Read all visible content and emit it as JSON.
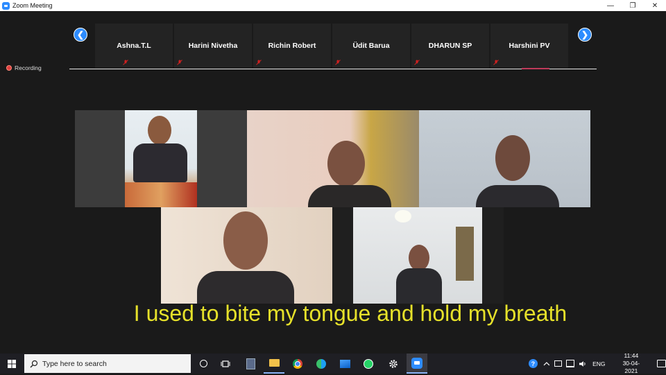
{
  "window": {
    "title": "Zoom Meeting"
  },
  "window_controls": {
    "minimize": "—",
    "restore": "❐",
    "close": "✕"
  },
  "strip": {
    "participants": [
      {
        "name": "Ashna.T.L"
      },
      {
        "name": "Harini Nivetha"
      },
      {
        "name": "Richin Robert"
      },
      {
        "name": "Üdit Barua"
      },
      {
        "name": "DHARUN SP"
      },
      {
        "name": "Harshini PV"
      }
    ],
    "prev_label": "❮",
    "next_label": "❯"
  },
  "recording": {
    "label": "Recording"
  },
  "caption": "I used to bite my tongue and hold my breath",
  "taskbar": {
    "search_placeholder": "Type here to search",
    "language": "ENG",
    "time": "11:44",
    "date": "30-04-2021"
  },
  "colors": {
    "accent": "#2d8cff",
    "caption": "#e6e12a",
    "recording": "#e04040",
    "mic_muted": "#d02020"
  }
}
